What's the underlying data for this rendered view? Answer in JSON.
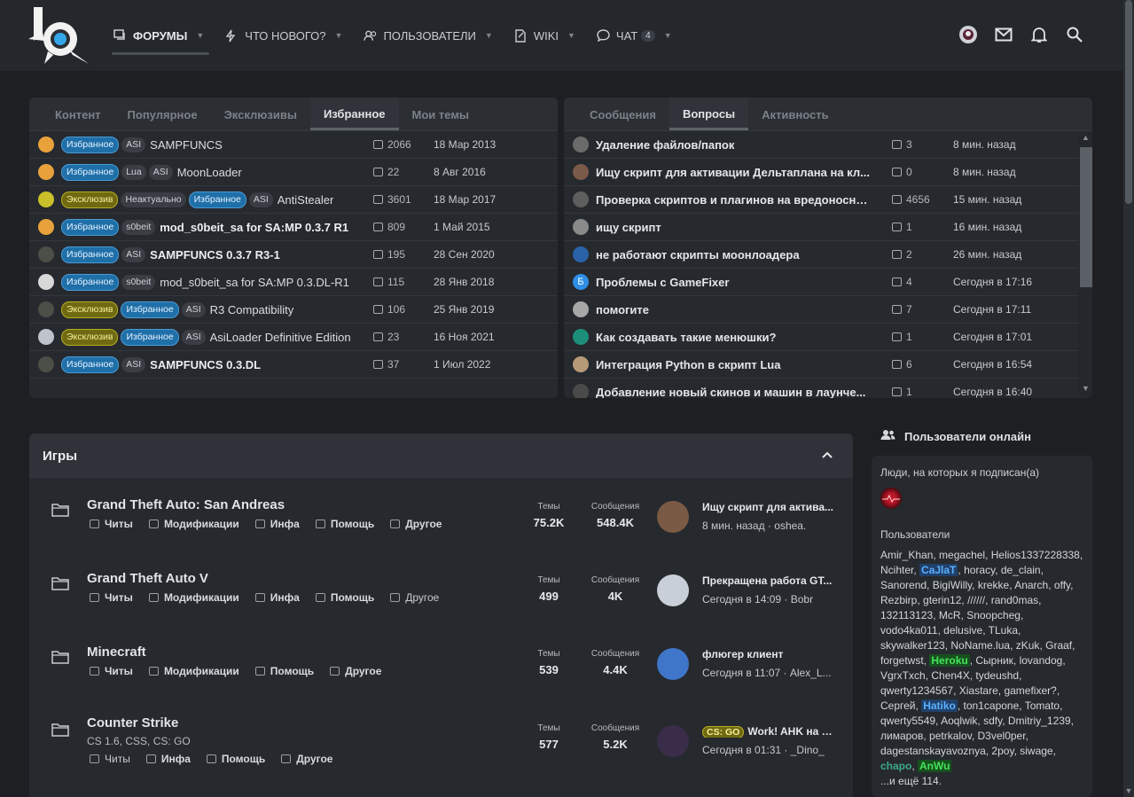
{
  "nav": {
    "items": [
      {
        "label": "Форумы",
        "icon": "forum-icon"
      },
      {
        "label": "Что нового?",
        "icon": "bolt-icon"
      },
      {
        "label": "Пользователи",
        "icon": "users-icon"
      },
      {
        "label": "Wiki",
        "icon": "wiki-icon"
      },
      {
        "label": "Чат",
        "icon": "chat-icon",
        "badge": "4"
      }
    ]
  },
  "left_panel": {
    "tabs": [
      "Контент",
      "Популярное",
      "Эксклюзивы",
      "Избранное",
      "Мои темы"
    ],
    "active_tab": "Избранное",
    "rows": [
      {
        "tags": [
          "Избранное",
          "ASI"
        ],
        "title": "SAMPFUNCS",
        "count": "2066",
        "date": "18 Мар 2013"
      },
      {
        "tags": [
          "Избранное",
          "Lua",
          "ASI"
        ],
        "title": "MoonLoader",
        "count": "22",
        "date": "8 Авг 2016"
      },
      {
        "tags": [
          "Эксклюзив",
          "Неактуально",
          "Избранное",
          "ASI"
        ],
        "title": "AntiStealer",
        "count": "3601",
        "date": "18 Мар 2017"
      },
      {
        "tags": [
          "Избранное",
          "s0beit"
        ],
        "title": "mod_s0beit_sa for SA:MP 0.3.7 R1",
        "count": "809",
        "date": "1 Май 2015"
      },
      {
        "tags": [
          "Избранное",
          "ASI"
        ],
        "title": "SAMPFUNCS 0.3.7 R3-1",
        "count": "195",
        "date": "28 Сен 2020"
      },
      {
        "tags": [
          "Избранное",
          "s0beit"
        ],
        "title": "mod_s0beit_sa for SA:MP 0.3.DL-R1",
        "count": "115",
        "date": "28 Янв 2018"
      },
      {
        "tags": [
          "Эксклюзив",
          "Избранное",
          "ASI"
        ],
        "title": "R3 Compatibility",
        "count": "106",
        "date": "25 Янв 2019"
      },
      {
        "tags": [
          "Эксклюзив",
          "Избранное",
          "ASI"
        ],
        "title": "AsiLoader Definitive Edition",
        "count": "23",
        "date": "16 Ноя 2021"
      },
      {
        "tags": [
          "Избранное",
          "ASI"
        ],
        "title": "SAMPFUNCS 0.3.DL",
        "count": "37",
        "date": "1 Июл 2022"
      }
    ]
  },
  "right_panel": {
    "tabs": [
      "Сообщения",
      "Вопросы",
      "Активность"
    ],
    "active_tab": "Вопросы",
    "rows": [
      {
        "title": "Удаление файлов/папок",
        "count": "3",
        "time": "8 мин. назад"
      },
      {
        "title": "Ищу скрипт для активации Дельтаплана на кл...",
        "count": "0",
        "time": "8 мин. назад"
      },
      {
        "title": "Проверка скриптов и плагинов на вредоносно...",
        "count": "4656",
        "time": "15 мин. назад"
      },
      {
        "title": "ищу скрипт",
        "count": "1",
        "time": "16 мин. назад"
      },
      {
        "title": "не работают скрипты моонлоадера",
        "count": "2",
        "time": "26 мин. назад"
      },
      {
        "title": "Проблемы с GameFixer",
        "count": "4",
        "time": "Сегодня в 17:16",
        "avatar_letter": "Б"
      },
      {
        "title": "помогите",
        "count": "7",
        "time": "Сегодня в 17:11"
      },
      {
        "title": "Как создавать такие менюшки?",
        "count": "1",
        "time": "Сегодня в 17:01"
      },
      {
        "title": "Интеграция Python в скрипт Lua",
        "count": "6",
        "time": "Сегодня в 16:54"
      },
      {
        "title": "Добавление новый скинов и машин в лаунче...",
        "count": "1",
        "time": "Сегодня в 16:40"
      }
    ]
  },
  "games": {
    "title": "Игры",
    "stat_labels": {
      "themes": "Темы",
      "messages": "Сообщения"
    },
    "nodes": [
      {
        "title": "Grand Theft Auto: San Andreas",
        "desc": "",
        "subs": [
          "Читы",
          "Модификации",
          "Инфа",
          "Помощь",
          "Другое"
        ],
        "themes": "75.2K",
        "messages": "548.4K",
        "last_title": "Ищу скрипт для актива...",
        "last_meta": "8 мин. назад · oshea.",
        "last_prefix": ""
      },
      {
        "title": "Grand Theft Auto V",
        "desc": "",
        "subs": [
          "Читы",
          "Модификации",
          "Инфа",
          "Помощь",
          "Другое"
        ],
        "themes": "499",
        "messages": "4K",
        "last_title": "Прекращена работа GT...",
        "last_meta": "Сегодня в 14:09 · Bobr",
        "last_prefix": ""
      },
      {
        "title": "Minecraft",
        "desc": "",
        "subs": [
          "Читы",
          "Модификации",
          "Помощь",
          "Другое"
        ],
        "themes": "539",
        "messages": "4.4K",
        "last_title": "флюгер клиент",
        "last_meta": "Сегодня в 11:07 · Alex_L...",
        "last_prefix": ""
      },
      {
        "title": "Counter Strike",
        "desc": "CS 1.6, CSS, CS: GO",
        "subs": [
          "Читы",
          "Инфа",
          "Помощь",
          "Другое"
        ],
        "themes": "577",
        "messages": "5.2K",
        "last_title": "Work! AHK на W...",
        "last_meta": "Сегодня в 01:31 · _Dino_",
        "last_prefix": "CS: GO"
      }
    ]
  },
  "online": {
    "title": "Пользователи онлайн",
    "following_label": "Люди, на которых я подписан(а)",
    "users_label": "Пользователи",
    "more": "...и ещё 114.",
    "users": [
      {
        "n": "Amir_Khan",
        "s": ""
      },
      {
        "n": "megachel",
        "s": ""
      },
      {
        "n": "Helios1337228338",
        "s": ""
      },
      {
        "n": "Ncihter",
        "s": ""
      },
      {
        "n": "CaJlaT",
        "s": "blue"
      },
      {
        "n": "horacy",
        "s": ""
      },
      {
        "n": "de_clain",
        "s": ""
      },
      {
        "n": "Sanorend",
        "s": ""
      },
      {
        "n": "BigiWilly",
        "s": ""
      },
      {
        "n": "krekke",
        "s": ""
      },
      {
        "n": "Anarch",
        "s": ""
      },
      {
        "n": "offy",
        "s": ""
      },
      {
        "n": "Rezbirp",
        "s": ""
      },
      {
        "n": "gterin12",
        "s": ""
      },
      {
        "n": "//////",
        "s": ""
      },
      {
        "n": "rand0mas",
        "s": ""
      },
      {
        "n": "132113123",
        "s": ""
      },
      {
        "n": "McR",
        "s": ""
      },
      {
        "n": "Snoopcheg",
        "s": ""
      },
      {
        "n": "vodo4ka011",
        "s": ""
      },
      {
        "n": "delusive",
        "s": ""
      },
      {
        "n": "TLuka",
        "s": ""
      },
      {
        "n": "skywalker123",
        "s": ""
      },
      {
        "n": "NoName.lua",
        "s": ""
      },
      {
        "n": "zKuk",
        "s": ""
      },
      {
        "n": "Graaf",
        "s": ""
      },
      {
        "n": "forgetwst",
        "s": ""
      },
      {
        "n": "Heroku",
        "s": "green"
      },
      {
        "n": "Сырник",
        "s": ""
      },
      {
        "n": "lovandog",
        "s": ""
      },
      {
        "n": "VgrxTxch",
        "s": ""
      },
      {
        "n": "Chen4X",
        "s": ""
      },
      {
        "n": "tydeushd",
        "s": ""
      },
      {
        "n": "qwerty1234567",
        "s": ""
      },
      {
        "n": "Xiastare",
        "s": ""
      },
      {
        "n": "gamefixer?",
        "s": ""
      },
      {
        "n": "Сергей",
        "s": ""
      },
      {
        "n": "Hatiko",
        "s": "blue"
      },
      {
        "n": "ton1capone",
        "s": ""
      },
      {
        "n": "Tomato",
        "s": ""
      },
      {
        "n": "qwerty5549",
        "s": ""
      },
      {
        "n": "Aoqlwik",
        "s": ""
      },
      {
        "n": "sdfy",
        "s": ""
      },
      {
        "n": "Dmitriy_1239",
        "s": ""
      },
      {
        "n": "лимаров",
        "s": ""
      },
      {
        "n": "petrkalov",
        "s": ""
      },
      {
        "n": "D3vel0per",
        "s": ""
      },
      {
        "n": "dagestanskayavoznya",
        "s": ""
      },
      {
        "n": "2poy",
        "s": ""
      },
      {
        "n": "siwage",
        "s": ""
      },
      {
        "n": "chapo",
        "s": "teal"
      },
      {
        "n": "AnWu",
        "s": "green"
      }
    ]
  },
  "colors": {
    "favorite": "#1f6fa8",
    "exclusive": "#6f6a12",
    "panel": "#26292e",
    "bg": "#1d1f23"
  }
}
